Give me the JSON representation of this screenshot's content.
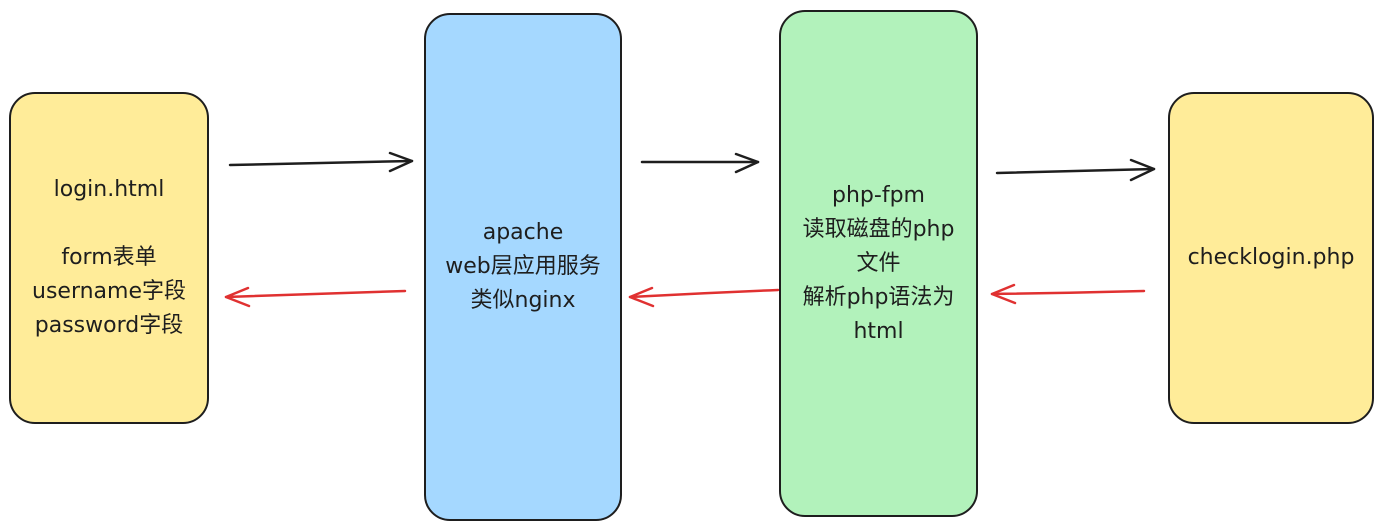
{
  "colors": {
    "stroke": "#1e1e1e",
    "request_arrow": "#1e1e1e",
    "response_arrow": "#e03131",
    "login_fill": "#ffec99",
    "apache_fill": "#a5d8ff",
    "fpm_fill": "#b2f2bb",
    "check_fill": "#ffec99"
  },
  "nodes": {
    "login": {
      "text": "login.html\n\nform表单\nusername字段\npassword字段"
    },
    "apache": {
      "text": "apache\nweb层应用服务\n类似nginx"
    },
    "fpm": {
      "text": "php-fpm\n读取磁盘的php文件\n解析php语法为html"
    },
    "check": {
      "text": "checklogin.php"
    }
  },
  "edges": [
    {
      "from": "login",
      "to": "apache",
      "kind": "request"
    },
    {
      "from": "apache",
      "to": "login",
      "kind": "response"
    },
    {
      "from": "apache",
      "to": "fpm",
      "kind": "request"
    },
    {
      "from": "fpm",
      "to": "apache",
      "kind": "response"
    },
    {
      "from": "fpm",
      "to": "check",
      "kind": "request"
    },
    {
      "from": "check",
      "to": "fpm",
      "kind": "response"
    }
  ]
}
